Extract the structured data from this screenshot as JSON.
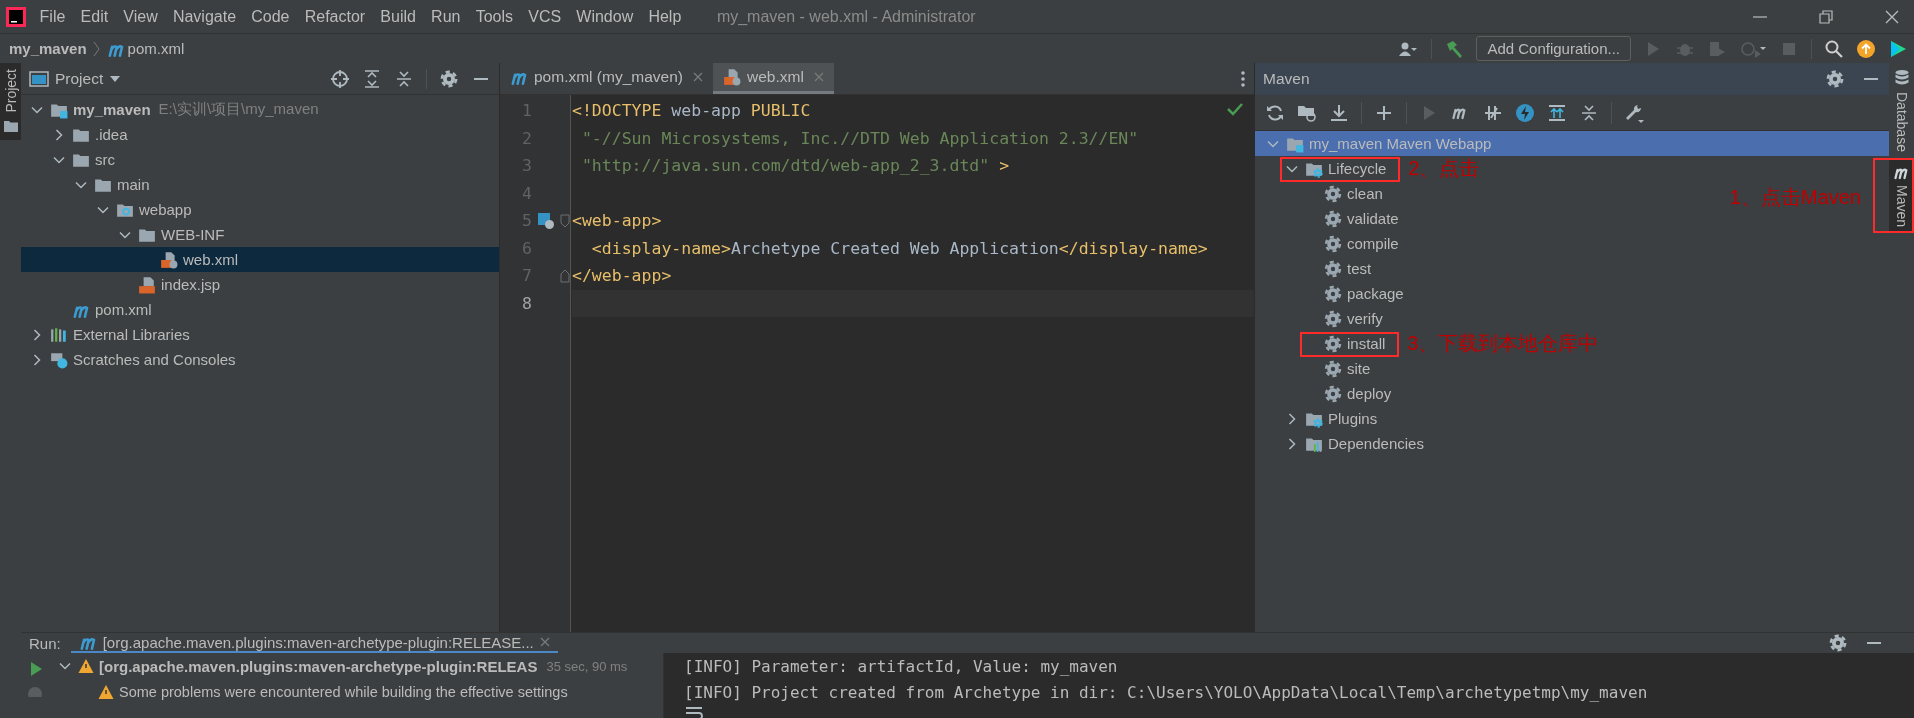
{
  "app": {
    "title": "my_maven - web.xml - Administrator",
    "menu": [
      "File",
      "Edit",
      "View",
      "Navigate",
      "Code",
      "Refactor",
      "Build",
      "Run",
      "Tools",
      "VCS",
      "Window",
      "Help"
    ]
  },
  "navbar": {
    "breadcrumbs": [
      {
        "label": "my_maven",
        "kind": "project"
      },
      {
        "label": "pom.xml",
        "kind": "maven"
      }
    ],
    "run_config": "Add Configuration..."
  },
  "left_strip": [
    {
      "label": "Project",
      "selected": true
    }
  ],
  "project_panel": {
    "title": "Project",
    "tree": [
      {
        "label": "my_maven",
        "hint": "E:\\实训\\项目\\my_maven",
        "kind": "module",
        "expanded": true,
        "selected": false,
        "children": [
          {
            "label": ".idea",
            "kind": "folder",
            "expanded": false,
            "selected": false
          },
          {
            "label": "src",
            "kind": "folder",
            "expanded": true,
            "selected": false,
            "children": [
              {
                "label": "main",
                "kind": "folder",
                "expanded": true,
                "selected": false,
                "children": [
                  {
                    "label": "webapp",
                    "kind": "webfolder",
                    "expanded": true,
                    "selected": false,
                    "children": [
                      {
                        "label": "WEB-INF",
                        "kind": "folder",
                        "expanded": true,
                        "selected": false,
                        "children": [
                          {
                            "label": "web.xml",
                            "kind": "xml",
                            "selected": true
                          }
                        ]
                      },
                      {
                        "label": "index.jsp",
                        "kind": "jsp",
                        "selected": false
                      }
                    ]
                  }
                ]
              }
            ]
          },
          {
            "label": "pom.xml",
            "kind": "maven",
            "selected": false
          }
        ]
      },
      {
        "label": "External Libraries",
        "kind": "libraries",
        "expanded": false,
        "selected": false
      },
      {
        "label": "Scratches and Consoles",
        "kind": "scratches",
        "expanded": false,
        "selected": false
      }
    ]
  },
  "editor": {
    "tabs": [
      {
        "label": "pom.xml (my_maven)",
        "kind": "maven",
        "selected": false
      },
      {
        "label": "web.xml",
        "kind": "xml",
        "selected": true
      }
    ],
    "lines": [
      {
        "number": "1",
        "current": false,
        "segments": [
          {
            "text": "<!DOCTYPE ",
            "kind": "tag"
          },
          {
            "text": "web-app",
            "kind": "text"
          },
          {
            "text": " PUBLIC",
            "kind": "tag"
          }
        ]
      },
      {
        "number": "2",
        "current": false,
        "segments": [
          {
            "text": " \"-//Sun Microsystems, Inc.//DTD Web Application 2.3//EN\"",
            "kind": "string"
          }
        ]
      },
      {
        "number": "3",
        "current": false,
        "segments": [
          {
            "text": " \"http://java.sun.com/dtd/web-app_2_3.dtd\"",
            "kind": "string"
          },
          {
            "text": " >",
            "kind": "tag"
          }
        ]
      },
      {
        "number": "4",
        "current": false
      },
      {
        "number": "5",
        "current": false,
        "gutter_icon": true,
        "fold_start": true,
        "segments": [
          {
            "text": "<web-app>",
            "kind": "tag"
          }
        ]
      },
      {
        "number": "6",
        "current": false,
        "segments": [
          {
            "text": "  <display-name>",
            "kind": "tag"
          },
          {
            "text": "Archetype Created Web Application",
            "kind": "text"
          },
          {
            "text": "</display-name>",
            "kind": "tag"
          }
        ]
      },
      {
        "number": "7",
        "current": false,
        "fold_end": true,
        "segments": [
          {
            "text": "</web-app>",
            "kind": "tag"
          }
        ]
      },
      {
        "number": "8",
        "current": true
      }
    ]
  },
  "maven_panel": {
    "title": "Maven",
    "tree": [
      {
        "label": "my_maven Maven Webapp",
        "kind": "module",
        "expanded": true,
        "selected": true,
        "annotated": false,
        "children": [
          {
            "label": "Lifecycle",
            "kind": "lifecycle",
            "expanded": true,
            "selected": false,
            "annotated": true,
            "note": "2、点击",
            "children": [
              {
                "label": "clean",
                "kind": "goal",
                "selected": false,
                "annotated": false
              },
              {
                "label": "validate",
                "kind": "goal",
                "selected": false,
                "annotated": false
              },
              {
                "label": "compile",
                "kind": "goal",
                "selected": false,
                "annotated": false
              },
              {
                "label": "test",
                "kind": "goal",
                "selected": false,
                "annotated": false
              },
              {
                "label": "package",
                "kind": "goal",
                "selected": false,
                "annotated": false
              },
              {
                "label": "verify",
                "kind": "goal",
                "selected": false,
                "annotated": false
              },
              {
                "label": "install",
                "kind": "goal",
                "selected": false,
                "annotated": true,
                "note": "3、下载到本地仓库中"
              },
              {
                "label": "site",
                "kind": "goal",
                "selected": false,
                "annotated": false
              },
              {
                "label": "deploy",
                "kind": "goal",
                "selected": false,
                "annotated": false
              }
            ]
          },
          {
            "label": "Plugins",
            "kind": "plugins",
            "expanded": false,
            "selected": false,
            "annotated": false
          },
          {
            "label": "Dependencies",
            "kind": "deps",
            "expanded": false,
            "selected": false,
            "annotated": false
          }
        ]
      }
    ]
  },
  "right_strip": [
    {
      "label": "Database",
      "kind": "database",
      "selected": false,
      "annotated": false
    },
    {
      "label": "Maven",
      "kind": "maven",
      "selected": true,
      "annotated": true,
      "note": "1、点击Maven"
    }
  ],
  "run_panel": {
    "label": "Run:",
    "tab": "[org.apache.maven.plugins:maven-archetype-plugin:RELEASE...",
    "tree": [
      {
        "text": "[org.apache.maven.plugins:maven-archetype-plugin:RELEAS",
        "time": "35 sec, 90 ms",
        "kind": "warning",
        "expanded": true,
        "children": [
          {
            "text": "Some problems were encountered while building the effective settings",
            "kind": "warning"
          }
        ]
      }
    ],
    "console": [
      "[INFO] Parameter: artifactId, Value: my_maven",
      "[INFO] Project created from Archetype in dir: C:\\Users\\YOLO\\AppData\\Local\\Temp\\archetypetmp\\my_maven"
    ]
  }
}
